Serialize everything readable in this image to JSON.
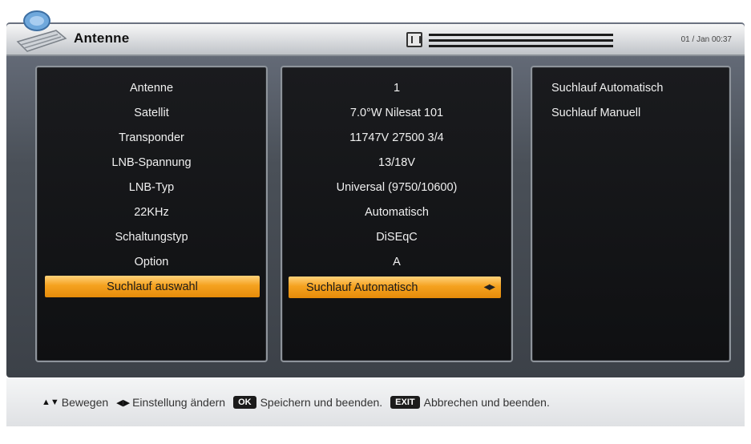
{
  "header": {
    "title": "Antenne",
    "datetime": "01 / Jan 00:37",
    "signal_icon": "signal-icon"
  },
  "settings": [
    {
      "label": "Antenne",
      "value": "1"
    },
    {
      "label": "Satellit",
      "value": "7.0°W Nilesat 101"
    },
    {
      "label": "Transponder",
      "value": "11747V 27500 3/4"
    },
    {
      "label": "LNB-Spannung",
      "value": "13/18V"
    },
    {
      "label": "LNB-Typ",
      "value": "Universal (9750/10600)"
    },
    {
      "label": "22KHz",
      "value": "Automatisch"
    },
    {
      "label": "Schaltungstyp",
      "value": "DiSEqC"
    },
    {
      "label": "Option",
      "value": "A"
    },
    {
      "label": "Suchlauf auswahl",
      "value": "Suchlauf Automatisch",
      "selected": true
    }
  ],
  "options": [
    "Suchlauf Automatisch",
    "Suchlauf Manuell"
  ],
  "footer": {
    "move": "Bewegen",
    "change": "Einstellung ändern",
    "ok_key": "OK",
    "ok_label": "Speichern und beenden.",
    "exit_key": "EXIT",
    "exit_label": "Abbrechen und beenden."
  },
  "colors": {
    "highlight": "#f5a21f",
    "panel_bg": "#121315",
    "frame": "#4a5058"
  }
}
